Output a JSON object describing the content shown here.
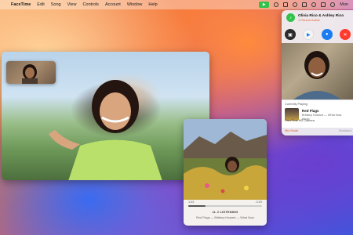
{
  "menubar": {
    "apple_icon": "apple-logo",
    "app_name": "FaceTime",
    "items": [
      "Edit",
      "Song",
      "View",
      "Controls",
      "Account",
      "Window",
      "Help"
    ],
    "clock": "Mon"
  },
  "facetime_panel": {
    "title": "Olivia Rico & Ashley Rico",
    "subtitle": "1 Person Active",
    "now_playing_label": "Currently Playing",
    "song_title": "Red Flags",
    "song_artist": "Brittany Howard — What Now",
    "song_extra": "Music",
    "camera_label": "FaceTime HD Camera",
    "mic_mode_label": "Mic Mode",
    "mic_mode_value": "Standard"
  },
  "music_window": {
    "time_elapsed": "1:03",
    "time_remaining": "-3:29",
    "progress": 0.23,
    "listening_label": "JL 2 LISTENING",
    "song_line": "Red Flags — Brittany Howard — What Now"
  },
  "colors": {
    "accent_green": "#31c24a",
    "accent_blue": "#1a7cf0",
    "accent_red": "#ff3b30",
    "accent_orange": "#e25c2b"
  }
}
